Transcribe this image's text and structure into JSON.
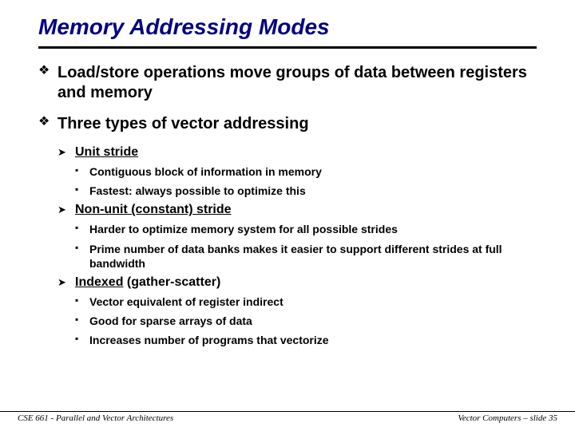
{
  "title": "Memory Addressing Modes",
  "b1a": "Load/store operations move groups of data between registers and memory",
  "b1b": "Three types of vector addressing",
  "s1": {
    "h": "Unit stride",
    "i1": "Contiguous block of information in memory",
    "i2": "Fastest: always possible to optimize this"
  },
  "s2": {
    "h": "Non-unit (constant) stride",
    "i1": "Harder to optimize memory system for all possible strides",
    "i2": "Prime number of data banks makes it easier to support different strides at full bandwidth"
  },
  "s3": {
    "h": "Indexed",
    "ht": " (gather-scatter)",
    "i1": "Vector equivalent of register indirect",
    "i2": "Good for sparse arrays of data",
    "i3": "Increases number of programs that vectorize"
  },
  "footer": {
    "left": "CSE 661 - Parallel and Vector Architectures",
    "right": "Vector Computers – slide 35"
  }
}
